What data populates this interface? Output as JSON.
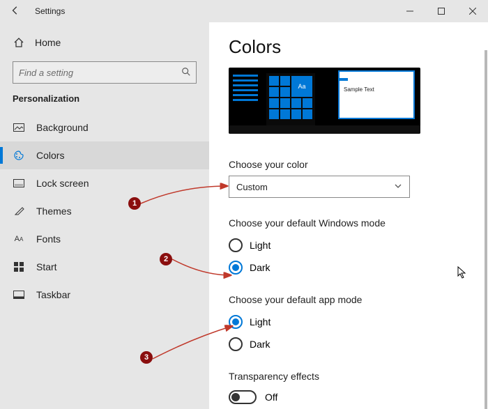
{
  "titlebar": {
    "title": "Settings"
  },
  "sidebar": {
    "home": "Home",
    "search_placeholder": "Find a setting",
    "category": "Personalization",
    "items": [
      {
        "label": "Background"
      },
      {
        "label": "Colors"
      },
      {
        "label": "Lock screen"
      },
      {
        "label": "Themes"
      },
      {
        "label": "Fonts"
      },
      {
        "label": "Start"
      },
      {
        "label": "Taskbar"
      }
    ]
  },
  "main": {
    "heading": "Colors",
    "preview": {
      "tile_text": "Aa",
      "sample_tab": "",
      "sample_text": "Sample Text"
    },
    "choose_color_label": "Choose your color",
    "choose_color_value": "Custom",
    "windows_mode_label": "Choose your default Windows mode",
    "windows_mode": {
      "light": "Light",
      "dark": "Dark",
      "selected": "dark"
    },
    "app_mode_label": "Choose your default app mode",
    "app_mode": {
      "light": "Light",
      "dark": "Dark",
      "selected": "light"
    },
    "transparency_label": "Transparency effects",
    "transparency_value": "Off"
  },
  "annotations": {
    "a1": "1",
    "a2": "2",
    "a3": "3"
  }
}
